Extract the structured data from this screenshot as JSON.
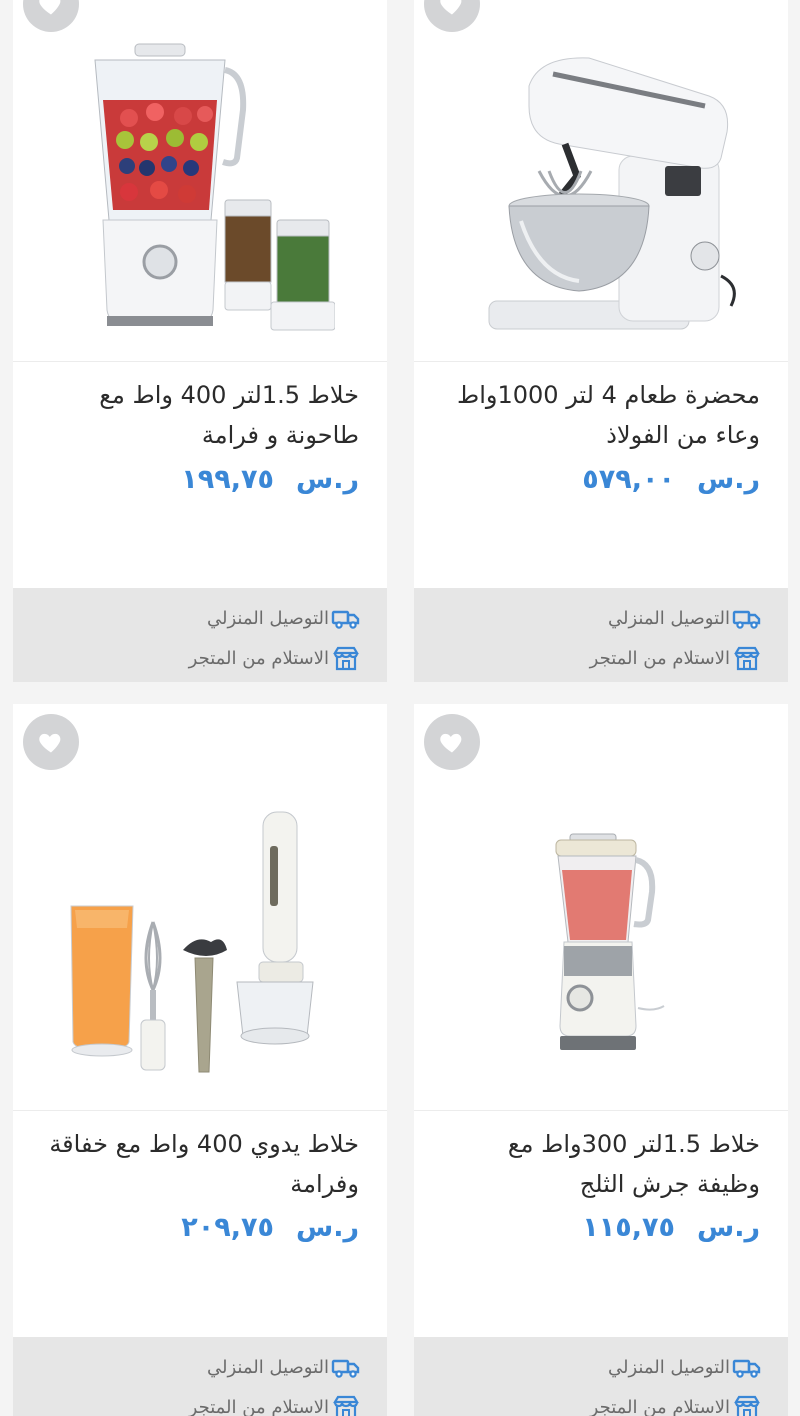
{
  "products": [
    {
      "title": "محضرة طعام 4 لتر 1000واط وعاء من الفولاذ",
      "currency": "ر.س",
      "price": "٥٧٩,٠٠",
      "delivery_label": "التوصيل المنزلي",
      "pickup_label": "الاستلام من المتجر",
      "image_icon": "stand-mixer"
    },
    {
      "title": "خلاط 1.5لتر 400 واط مع طاحونة و فرامة",
      "currency": "ر.س",
      "price": "١٩٩,٧٥",
      "delivery_label": "التوصيل المنزلي",
      "pickup_label": "الاستلام من المتجر",
      "image_icon": "blender-with-grinders"
    },
    {
      "title": "خلاط 1.5لتر 300واط مع وظيفة جرش الثلج",
      "currency": "ر.س",
      "price": "١١٥,٧٥",
      "delivery_label": "التوصيل المنزلي",
      "pickup_label": "الاستلام من المتجر",
      "image_icon": "blender"
    },
    {
      "title": "خلاط يدوي 400 واط مع خفاقة وفرامة",
      "currency": "ر.س",
      "price": "٢٠٩,٧٥",
      "delivery_label": "التوصيل المنزلي",
      "pickup_label": "الاستلام من المتجر",
      "image_icon": "hand-blender-set"
    }
  ],
  "colors": {
    "price": "#3a87d6",
    "icon_blue": "#3a87d6",
    "footer_bg": "#e6e6e6",
    "favorite_bg": "#d3d4d6"
  },
  "icons": {
    "favorite": "heart-icon",
    "delivery": "truck-icon",
    "pickup": "store-icon"
  }
}
